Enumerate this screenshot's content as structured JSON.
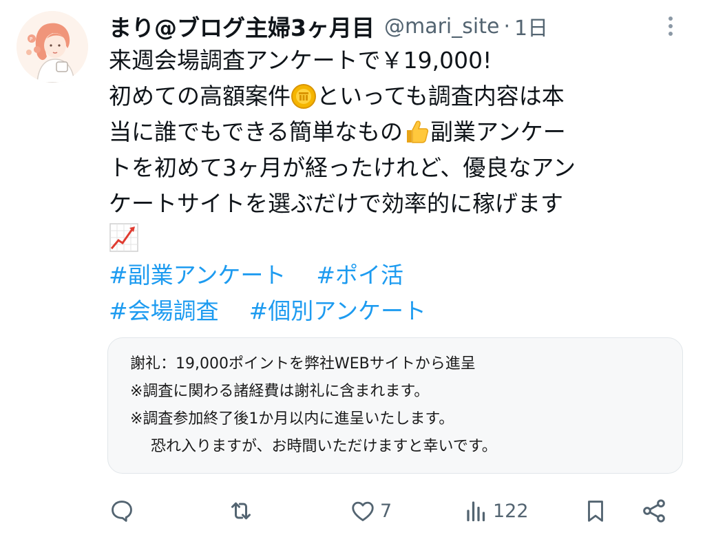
{
  "user": {
    "display_name": "まり@ブログ主婦3ヶ月目",
    "handle": "@mari_site",
    "separator": "·",
    "time": "1日"
  },
  "tweet": {
    "lines": [
      "来週会場調査アンケートで￥19,000!",
      "初めての高額案件",
      "といっても調査内容は本",
      "当に誰でもできる簡単なもの",
      "副業アンケー",
      "トを初めて3ヶ月が経ったけれど、優良なアン",
      "ケートサイトを選ぶだけで効率的に稼げます"
    ],
    "hashtags": [
      "#副業アンケート",
      "#ポイ活",
      "#会場調査",
      "#個別アンケート"
    ]
  },
  "card": {
    "lines": [
      "謝礼：19,000ポイントを弊社WEBサイトから進呈",
      "※調査に関わる諸経費は謝礼に含まれます。",
      "※調査参加終了後1か月以内に進呈いたします。",
      "恐れ入りますが、お時間いただけますと幸いです。"
    ]
  },
  "actions": {
    "likes": "7",
    "views": "122"
  },
  "icons": {
    "more": "more-vertical-icon",
    "coin": "coin-emoji",
    "thumbs": "thumbs-up-emoji",
    "chart": "chart-increasing-emoji",
    "reply": "reply-icon",
    "retweet": "retweet-icon",
    "like": "heart-icon",
    "views": "analytics-icon",
    "bookmark": "bookmark-icon",
    "share": "share-icon"
  },
  "colors": {
    "link": "#1d9bf0",
    "text": "#0f1419",
    "secondary": "#536471",
    "card_bg": "#f7f8f9",
    "card_border": "#e1e6ea"
  }
}
